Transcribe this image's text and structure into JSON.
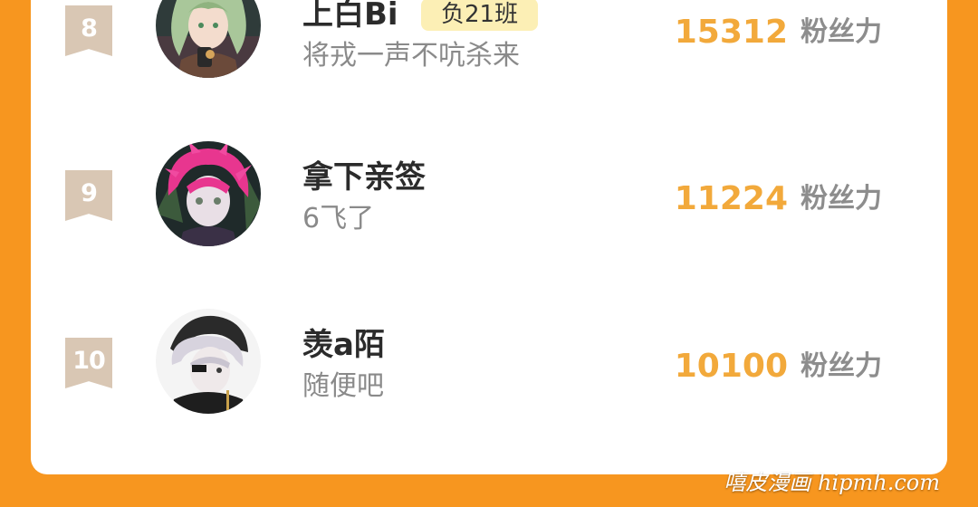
{
  "leaderboard": {
    "entries": [
      {
        "rank": "8",
        "name": "上白Bi",
        "badge": "负21班",
        "signature": "将戎一声不吭杀来",
        "score": "15312",
        "unit": "粉丝力",
        "avatar": "green-haired-character"
      },
      {
        "rank": "9",
        "name": "拿下亲签",
        "badge": "",
        "signature": "6飞了",
        "score": "11224",
        "unit": "粉丝力",
        "avatar": "pink-haired-character"
      },
      {
        "rank": "10",
        "name": "羡a陌",
        "badge": "",
        "signature": "随便吧",
        "score": "10100",
        "unit": "粉丝力",
        "avatar": "white-haired-character"
      }
    ]
  },
  "watermark": "嘻皮漫画 hipmh.com",
  "colors": {
    "background": "#f7961f",
    "score": "#f2a93b",
    "rank_badge": "#d9c7b4",
    "group_badge": "#fcefb5"
  }
}
